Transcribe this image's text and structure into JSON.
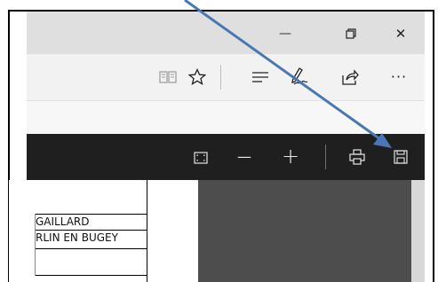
{
  "window": {
    "minimize_glyph": "—",
    "restore_glyph": "❐",
    "close_glyph": "✕"
  },
  "toolbar": {
    "reading_view_icon": "book-icon",
    "favorite_icon": "star-icon",
    "hub_icon": "hub-icon",
    "notes_icon": "pen-icon",
    "share_icon": "share-icon",
    "more_glyph": "···"
  },
  "pdf_toolbar": {
    "minus_glyph": "—",
    "plus_glyph": "+"
  },
  "document": {
    "row1": "GAILLARD",
    "row2": "RLIN EN BUGEY"
  },
  "colors": {
    "annotation_arrow": "#4a76b5",
    "pdf_toolbar": "#1f1f1f",
    "page_dark": "#4d4d4d"
  }
}
